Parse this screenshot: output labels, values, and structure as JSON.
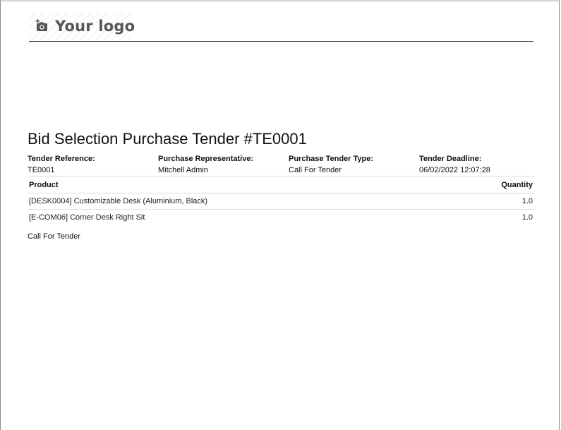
{
  "header": {
    "logo_icon": "camera-plus-icon",
    "logo_text": "Your logo"
  },
  "title": "Bid Selection Purchase Tender #TE0001",
  "info": [
    {
      "label": "Tender Reference:",
      "value": "TE0001"
    },
    {
      "label": "Purchase Representative:",
      "value": "Mitchell Admin"
    },
    {
      "label": "Purchase Tender Type:",
      "value": "Call For Tender"
    },
    {
      "label": "Tender Deadline:",
      "value": "06/02/2022 12:07:28"
    }
  ],
  "table": {
    "headers": {
      "product": "Product",
      "quantity": "Quantity"
    },
    "rows": [
      {
        "product": "[DESK0004] Customizable Desk (Aluminium, Black)",
        "quantity": "1.0"
      },
      {
        "product": "[E-COM06] Corner Desk Right Sit",
        "quantity": "1.0"
      }
    ]
  },
  "notes": "Call For Tender"
}
